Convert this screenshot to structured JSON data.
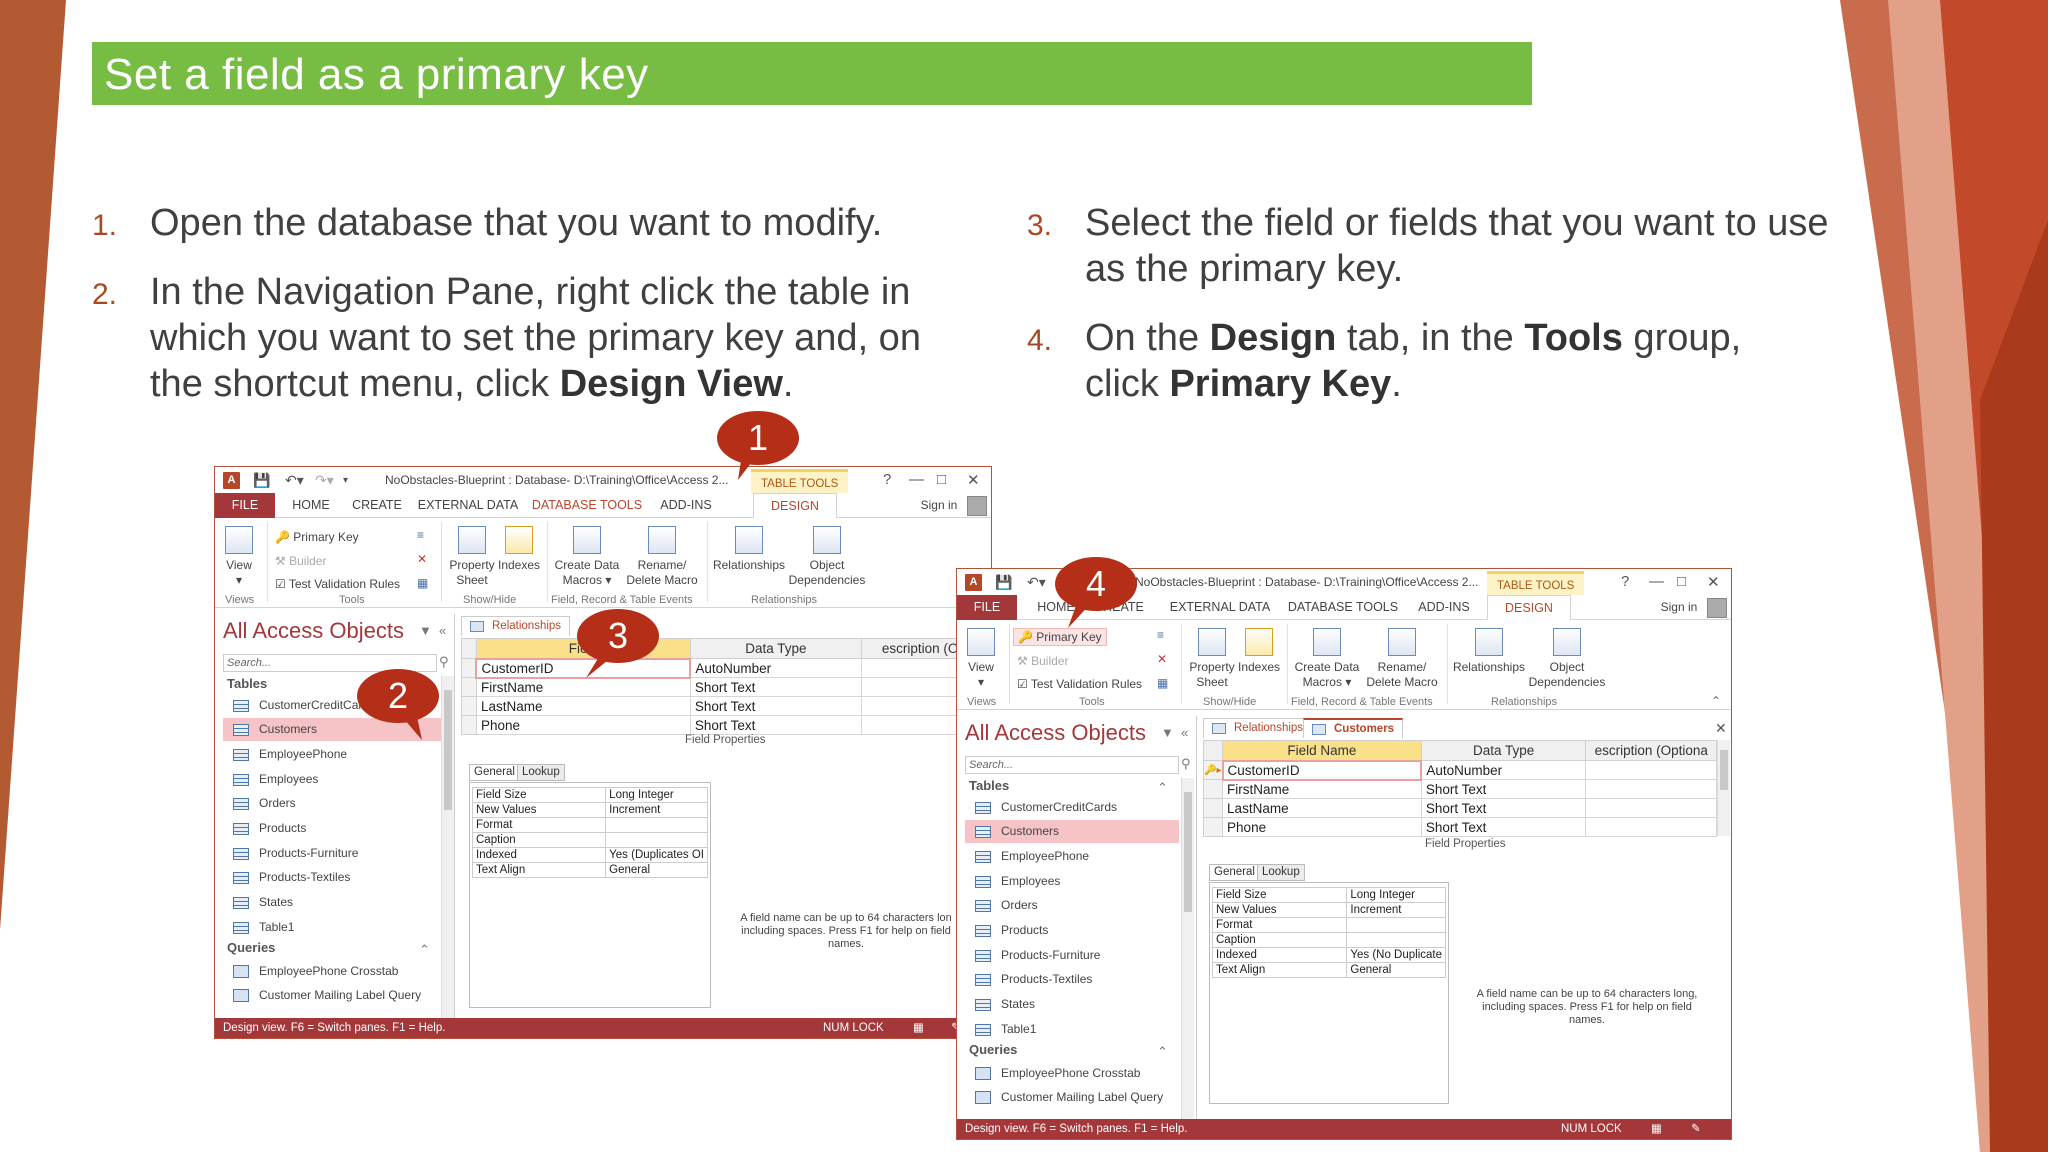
{
  "slide": {
    "title": "Set a field as a primary key"
  },
  "steps": [
    {
      "num": "1.",
      "text": "Open the database that you want to modify."
    },
    {
      "num": "2.",
      "line1": "In the Navigation Pane, right click the table in",
      "line2": "which you want to set the primary key and, on",
      "line3": "the shortcut menu, click ",
      "bold": "Design View",
      "end": "."
    },
    {
      "num": "3.",
      "line1": "Select the field or fields that you want to use",
      "line2": "as the primary key."
    },
    {
      "num": "4.",
      "p1": "On the ",
      "b1": "Design",
      "p2": " tab, in the ",
      "b2": "Tools",
      "p3": " group,",
      "p4": "click ",
      "b3": "Primary Key",
      "p5": "."
    }
  ],
  "win1": {
    "title": "NoObstacles-Blueprint : Database- D:\\Training\\Office\\Access 2...",
    "context": "TABLE TOOLS",
    "tabs": [
      "FILE",
      "HOME",
      "CREATE",
      "EXTERNAL DATA",
      "DATABASE TOOLS",
      "ADD-INS",
      "DESIGN"
    ],
    "signin": "Sign in"
  },
  "win2": {
    "title": "NoObstacles-Blueprint : Database- D:\\Training\\Office\\Access 2..."
  },
  "ribbon": {
    "view": "View",
    "primary_key": "Primary Key",
    "builder": "Builder",
    "test_validation": "Test Validation Rules",
    "property": "Property",
    "sheet": "Sheet",
    "indexes": "Indexes",
    "create_data": "Create Data",
    "macros": "Macros",
    "rename": "Rename/",
    "delete_macro": "Delete Macro",
    "relationships": "Relationships",
    "object": "Object",
    "dependencies": "Dependencies",
    "groups": {
      "views": "Views",
      "tools": "Tools",
      "show_hide": "Show/Hide",
      "events": "Field, Record & Table Events",
      "relationships": "Relationships"
    }
  },
  "nav": {
    "title": "All Access Objects",
    "search": "Search...",
    "tables_label": "Tables",
    "tables": {
      "0": "CustomerCreditCar",
      "0_full": "CustomerCreditCards",
      "1": "Customers",
      "2": "EmployeePhone",
      "3": "Employees",
      "4": "Orders",
      "5": "Products",
      "6": "Products-Furniture",
      "7": "Products-Textiles",
      "8": "States",
      "9": "Table1"
    },
    "queries_label": "Queries",
    "queries": [
      "EmployeePhone Crosstab",
      "Customer Mailing Label Query"
    ]
  },
  "doc": {
    "tab_relationships": "Relationships",
    "tab_customers": "Customers",
    "columns": {
      "0": "Field",
      "0_full": "Field Name",
      "1": "Data Type",
      "2": "escription (Optio",
      "2_alt": "escription (Optiona"
    },
    "rows": [
      {
        "name": "CustomerID",
        "type": "AutoNumber"
      },
      {
        "name": "FirstName",
        "type": "Short Text"
      },
      {
        "name": "LastName",
        "type": "Short Text"
      },
      {
        "name": "Phone",
        "type": "Short Text"
      }
    ],
    "field_properties": "Field Properties",
    "ptabs": [
      "General",
      "Lookup"
    ],
    "props": [
      {
        "k": "Field Size",
        "v": "Long Integer"
      },
      {
        "k": "New Values",
        "v": "Increment"
      },
      {
        "k": "Format",
        "v": ""
      },
      {
        "k": "Caption",
        "v": ""
      },
      {
        "k": "Indexed",
        "v_short": "Yes (Duplicates OI",
        "v_pk": "Yes (No Duplicate"
      },
      {
        "k": "Text Align",
        "v": "General"
      }
    ],
    "help1": [
      "A field name can be up to 64 characters lon",
      "including spaces. Press F1 for help on field",
      "names."
    ],
    "help2": [
      "A field name can be up to 64 characters long,",
      "including spaces. Press F1 for help on field",
      "names."
    ]
  },
  "status": {
    "text": "Design view.  F6 = Switch panes.  F1 = Help.",
    "numlock": "NUM LOCK"
  },
  "callouts": [
    "1",
    "2",
    "3",
    "4"
  ],
  "colors": {
    "title_bar": "#78bd43",
    "access_red": "#a4373a",
    "callout": "#b52f18",
    "step_number": "#a94922"
  }
}
